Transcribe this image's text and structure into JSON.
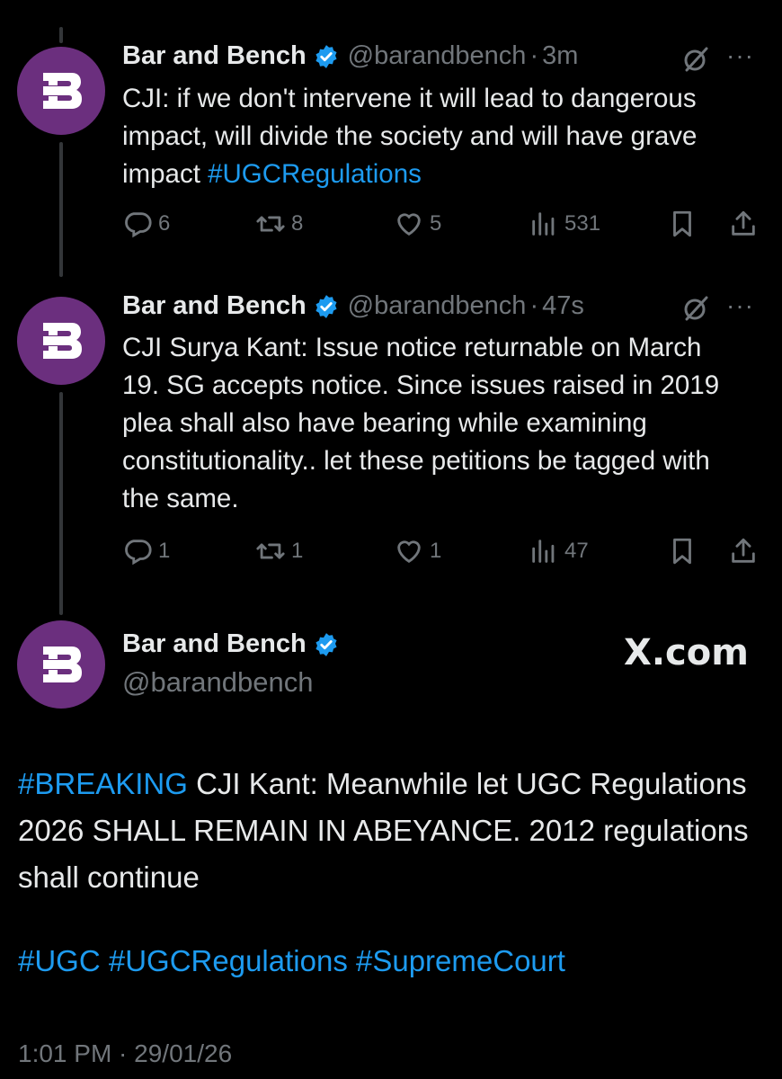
{
  "colors": {
    "accent": "#1d9bf0",
    "avatar_bg": "#6b2f7e",
    "muted": "#71767b",
    "text": "#e7e9ea"
  },
  "tweets": [
    {
      "name": "Bar and Bench",
      "handle": "@barandbench",
      "dot": "·",
      "time": "3m",
      "text": "CJI: if we don't intervene it will lead to dangerous impact, will divide the society and will have grave impact ",
      "hashtag": "#UGCRegulations",
      "replies": "6",
      "reposts": "8",
      "likes": "5",
      "views": "531"
    },
    {
      "name": "Bar and Bench",
      "handle": "@barandbench",
      "dot": "·",
      "time": "47s",
      "text": "CJI Surya Kant: Issue notice returnable on March 19. SG accepts notice. Since issues raised in 2019 plea shall also have bearing while examining constitutionality.. let these petitions be tagged with the same.",
      "replies": "1",
      "reposts": "1",
      "likes": "1",
      "views": "47"
    }
  ],
  "main": {
    "name": "Bar and Bench",
    "handle": "@barandbench",
    "watermark": "X.com",
    "breaking_tag": "#BREAKING",
    "text": " CJI Kant: Meanwhile let UGC Regulations 2026 SHALL REMAIN IN ABEYANCE. 2012 regulations shall continue",
    "tags": "#UGC #UGCRegulations #SupremeCourt",
    "timestamp": "1:01 PM · 29/01/26"
  },
  "icons": [
    "avatar-logo-icon",
    "verified-icon",
    "grok-icon",
    "more-icon",
    "reply-icon",
    "repost-icon",
    "like-icon",
    "views-icon",
    "bookmark-icon",
    "share-icon"
  ]
}
